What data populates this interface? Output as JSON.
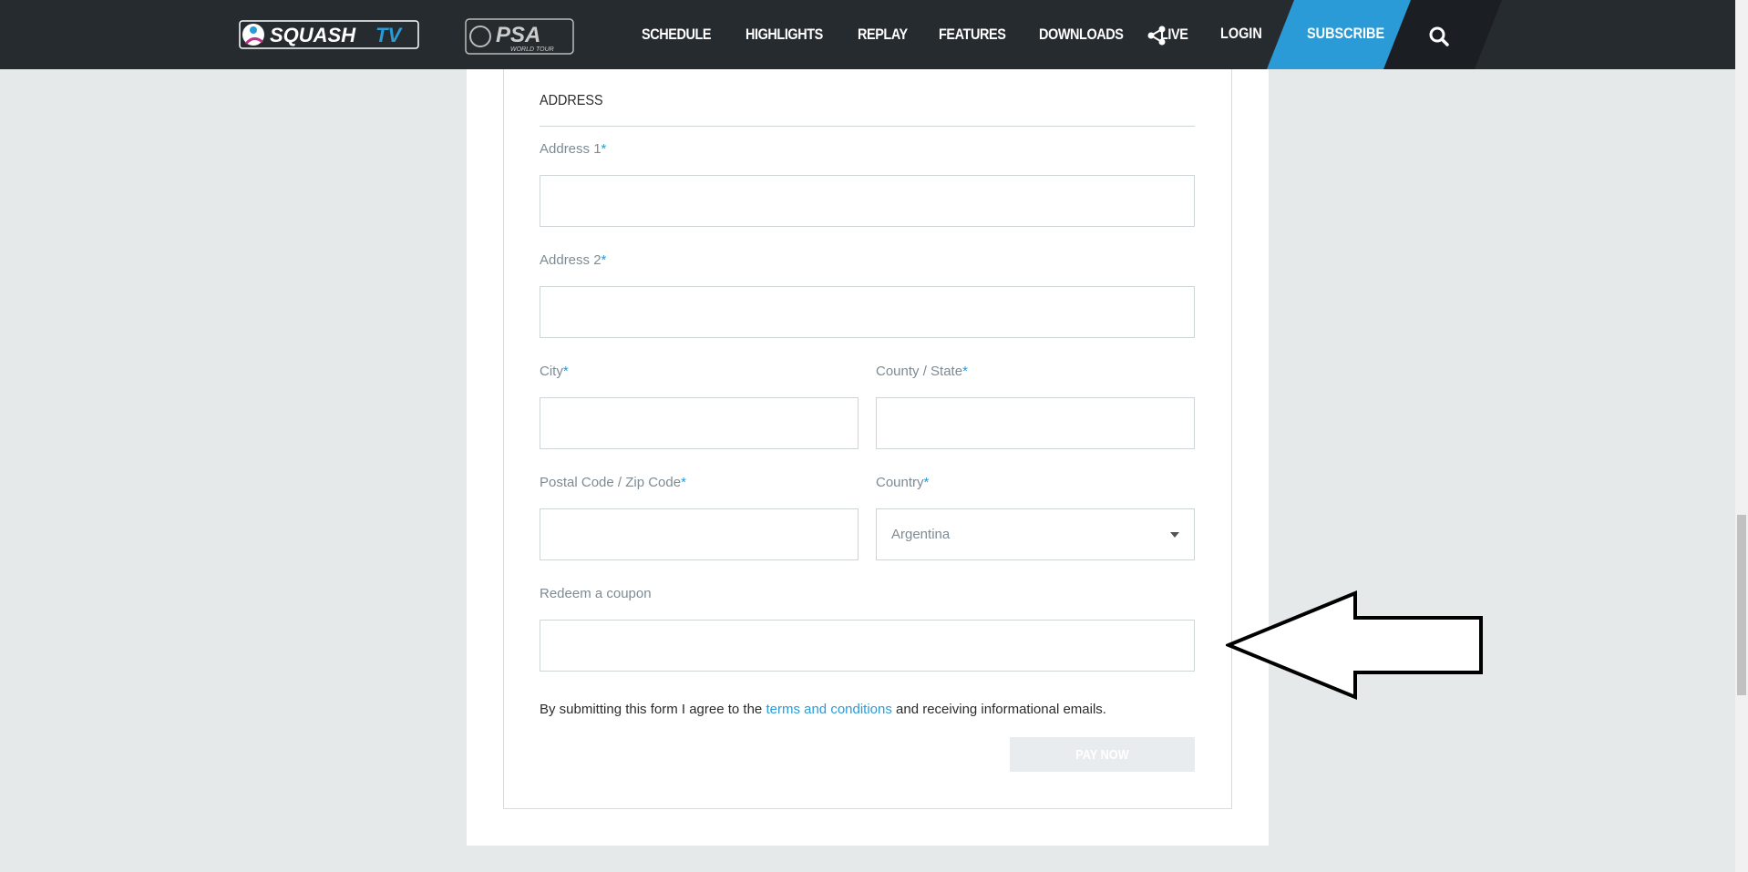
{
  "nav": {
    "logo_squash_text": "SQUASHTV",
    "logo_psa_text": "PSA",
    "logo_psa_sub": "WORLD TOUR",
    "links": [
      "SCHEDULE",
      "HIGHLIGHTS",
      "REPLAY",
      "FEATURES",
      "DOWNLOADS",
      "LIVE"
    ],
    "login": "LOGIN",
    "subscribe": "SUBSCRIBE",
    "subscribe_color": "#2a9bd6"
  },
  "form": {
    "section_title": "ADDRESS",
    "address1_label": "Address 1",
    "address2_label": "Address 2",
    "city_label": "City",
    "state_label": "County / State",
    "postal_label": "Postal Code / Zip Code",
    "country_label": "Country",
    "country_value": "Argentina",
    "coupon_label": "Redeem a coupon",
    "required_mark": "*",
    "terms_before": "By submitting this form I agree to the ",
    "terms_link": "terms and conditions",
    "terms_after": " and receiving informational emails.",
    "pay_button": "PAY NOW"
  }
}
